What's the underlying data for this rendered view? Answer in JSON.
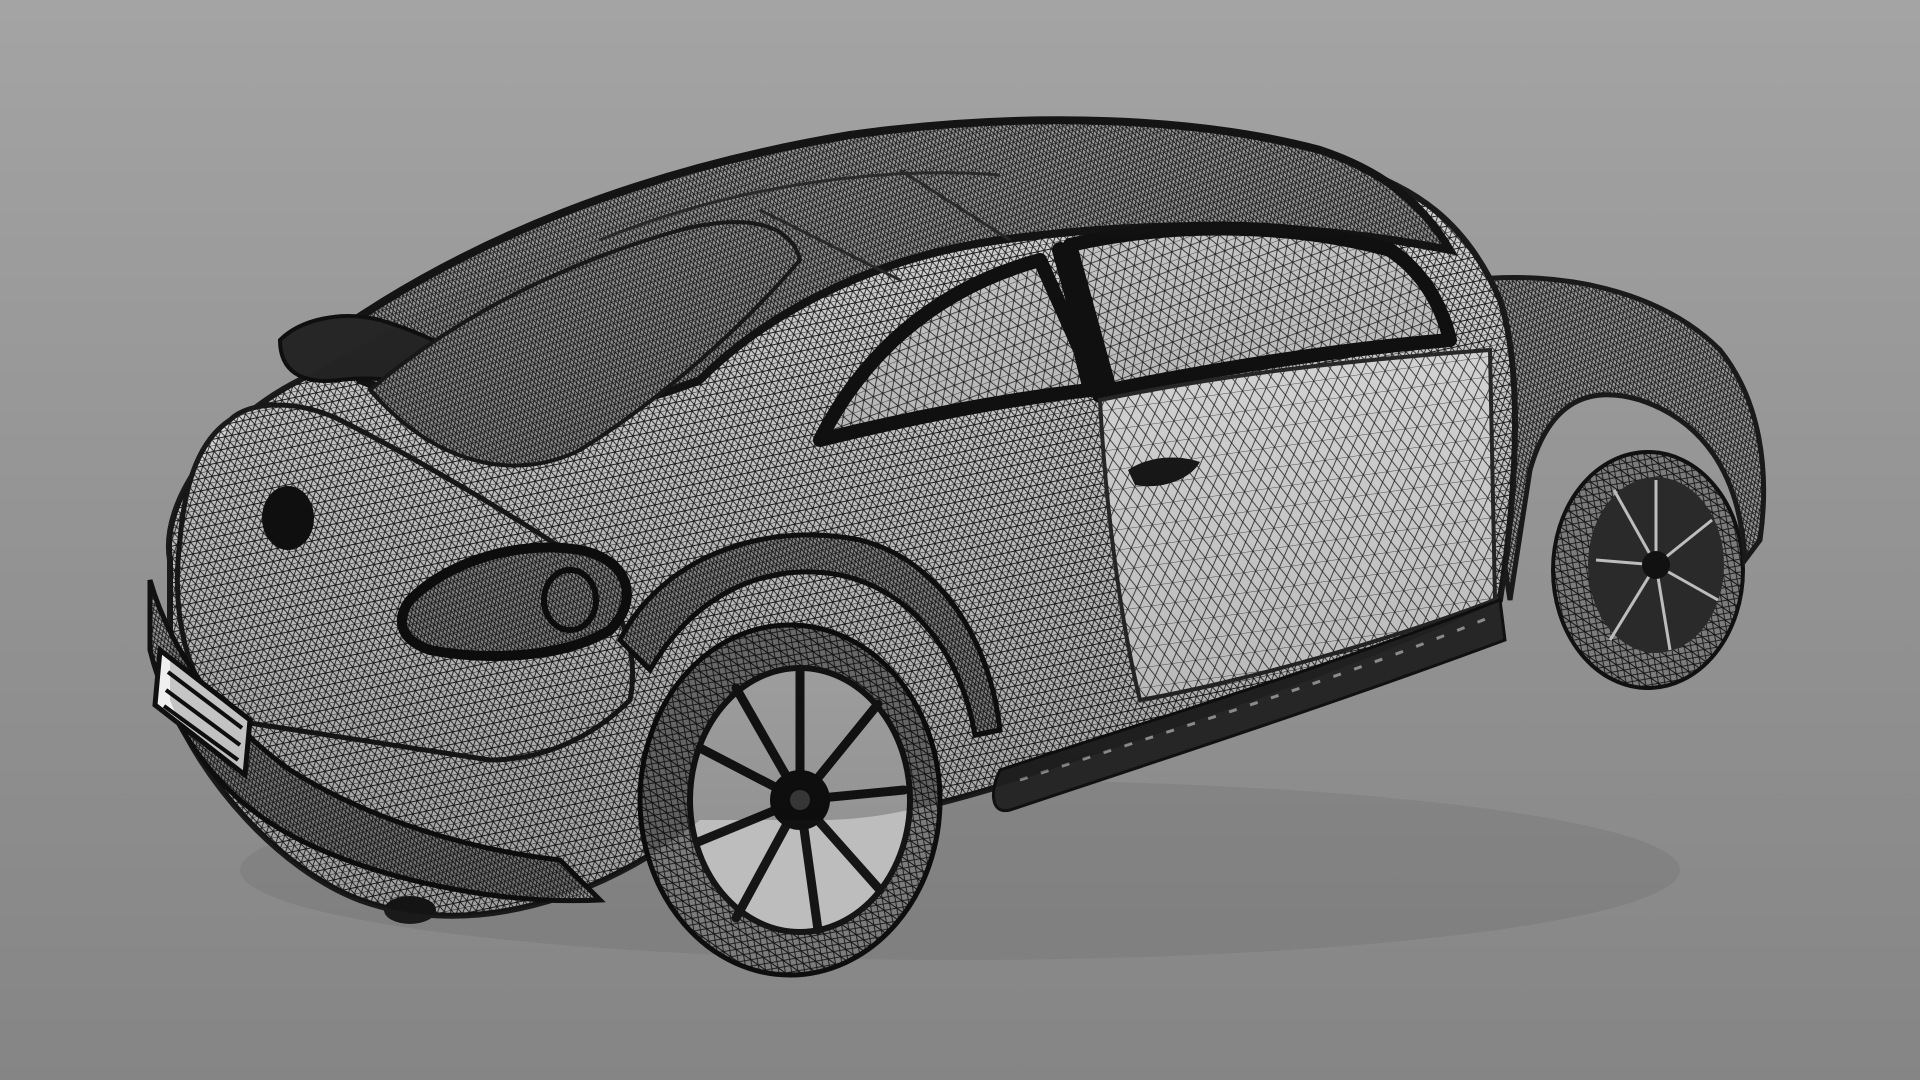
{
  "viewport": {
    "background_top": "#a4a4a4",
    "background_bottom": "#858585"
  },
  "model": {
    "subject": "car-wireframe-icon",
    "body_fill": "#d9d9d9",
    "mesh_line_color": "#1e1e1e",
    "dark_trim_color": "#262626"
  },
  "plate": {
    "text": ""
  }
}
